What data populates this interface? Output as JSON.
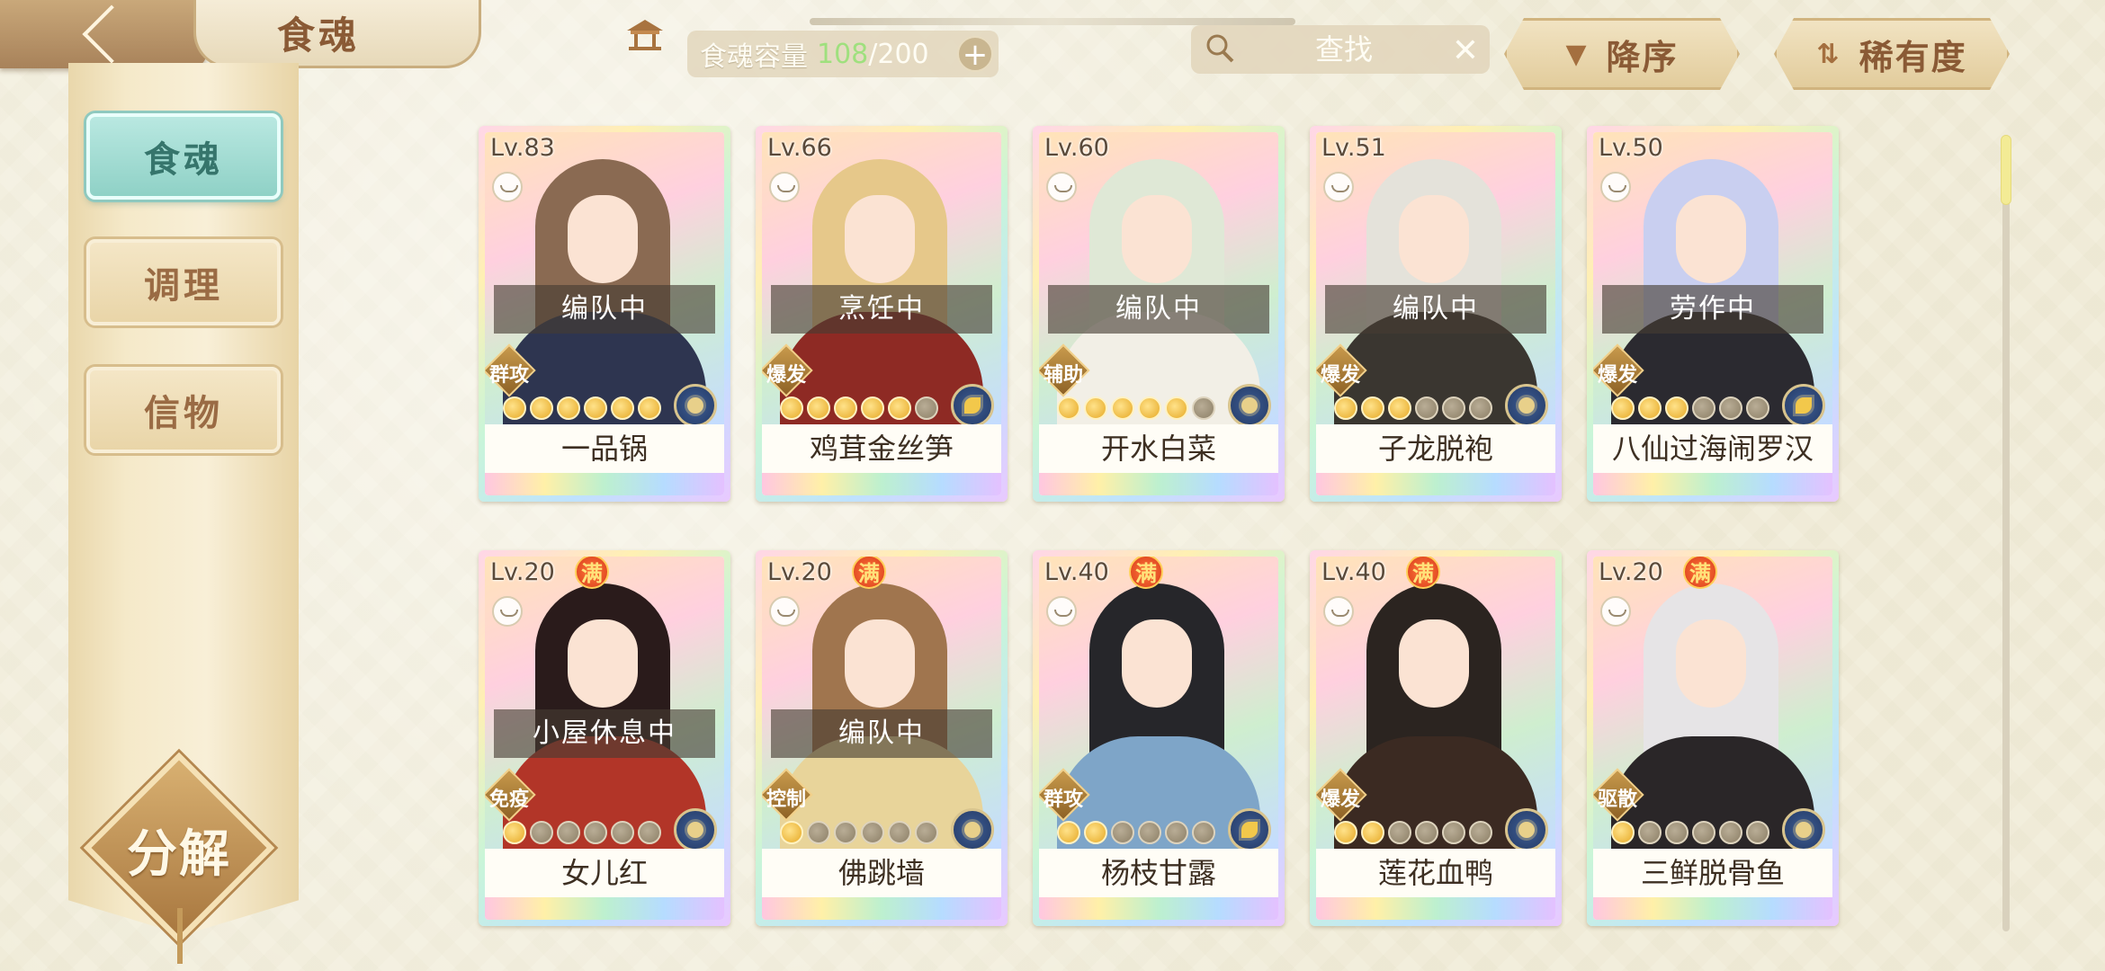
{
  "header": {
    "title": "食魂",
    "capacity_label": "食魂容量",
    "capacity_current": "108",
    "capacity_max": "/200",
    "capacity_add": "+",
    "search_placeholder": "查找",
    "search_clear": "✕",
    "sort_order_label": "降序",
    "sort_by_label": "稀有度"
  },
  "sidebar": {
    "tabs": [
      {
        "label": "食魂",
        "active": true
      },
      {
        "label": "调理",
        "active": false
      },
      {
        "label": "信物",
        "active": false
      }
    ],
    "decompose_label": "分解"
  },
  "cards": [
    {
      "level": "Lv.83",
      "max": "",
      "status": "编队中",
      "role": "群攻",
      "name": "一品锅",
      "stars_lit": 6,
      "hair": "#8a6a52",
      "outfit": "#2e3550"
    },
    {
      "level": "Lv.66",
      "max": "",
      "status": "烹饪中",
      "role": "爆发",
      "name": "鸡茸金丝笋",
      "stars_lit": 5,
      "hair": "#e6c88a",
      "outfit": "#8e2a24"
    },
    {
      "level": "Lv.60",
      "max": "",
      "status": "编队中",
      "role": "辅助",
      "name": "开水白菜",
      "stars_lit": 5,
      "hair": "#dfe8d6",
      "outfit": "#f2efe6"
    },
    {
      "level": "Lv.51",
      "max": "",
      "status": "编队中",
      "role": "爆发",
      "name": "子龙脱袍",
      "stars_lit": 3,
      "hair": "#e4e2da",
      "outfit": "#3a3630"
    },
    {
      "level": "Lv.50",
      "max": "",
      "status": "劳作中",
      "role": "爆发",
      "name": "八仙过海闹罗汉",
      "stars_lit": 3,
      "hair": "#c9cff0",
      "outfit": "#2b2a30"
    },
    {
      "level": "Lv.20",
      "max": "满",
      "status": "小屋休息中",
      "role": "免疫",
      "name": "女儿红",
      "stars_lit": 1,
      "hair": "#2a1b1b",
      "outfit": "#b23528"
    },
    {
      "level": "Lv.20",
      "max": "满",
      "status": "编队中",
      "role": "控制",
      "name": "佛跳墙",
      "stars_lit": 1,
      "hair": "#a0754e",
      "outfit": "#e8d49a"
    },
    {
      "level": "Lv.40",
      "max": "满",
      "status": "",
      "role": "群攻",
      "name": "杨枝甘露",
      "stars_lit": 2,
      "hair": "#26262a",
      "outfit": "#7ea5c8"
    },
    {
      "level": "Lv.40",
      "max": "满",
      "status": "",
      "role": "爆发",
      "name": "莲花血鸭",
      "stars_lit": 2,
      "hair": "#2b2420",
      "outfit": "#3b2a22"
    },
    {
      "level": "Lv.20",
      "max": "满",
      "status": "",
      "role": "驱散",
      "name": "三鲜脱骨鱼",
      "stars_lit": 1,
      "hair": "#e6e4e6",
      "outfit": "#2a2628"
    }
  ],
  "colors": {
    "accent_tab": "#8fd1c6",
    "brown_text": "#8a5a35",
    "capacity_green": "#9fe07e"
  }
}
